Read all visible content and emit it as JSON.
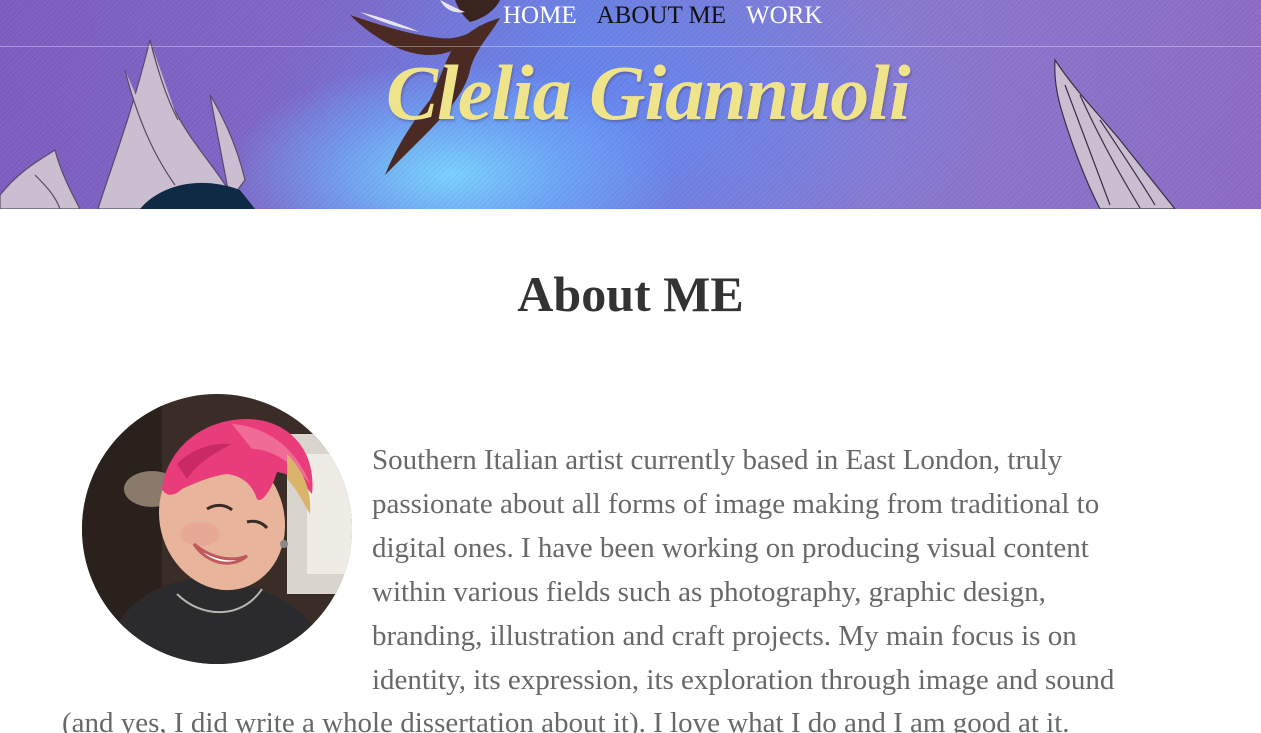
{
  "nav": {
    "items": [
      {
        "label": "HOME"
      },
      {
        "label": "ABOUT ME"
      },
      {
        "label": "WORK"
      }
    ],
    "active_index": 1
  },
  "brand": {
    "name": "Clelia Giannuoli"
  },
  "colors": {
    "brand_text": "#f0e48a",
    "banner_purple": "#8a70cc",
    "banner_blue": "#6fb8ff",
    "body_text": "#686868",
    "heading_text": "#333333"
  },
  "about": {
    "title": "About ME",
    "bio_lines": [
      "Southern Italian artist currently based in East London, truly",
      "passionate about all forms of image making from traditional to",
      "digital ones. I have been working on producing visual content",
      "within various fields such as photography, graphic design,",
      "branding, illustration and craft projects. My main focus is on",
      "identity, its expression, its exploration through image and sound",
      "(and yes, I did write a whole dissertation about it). I love what I do and I am good at it."
    ]
  }
}
